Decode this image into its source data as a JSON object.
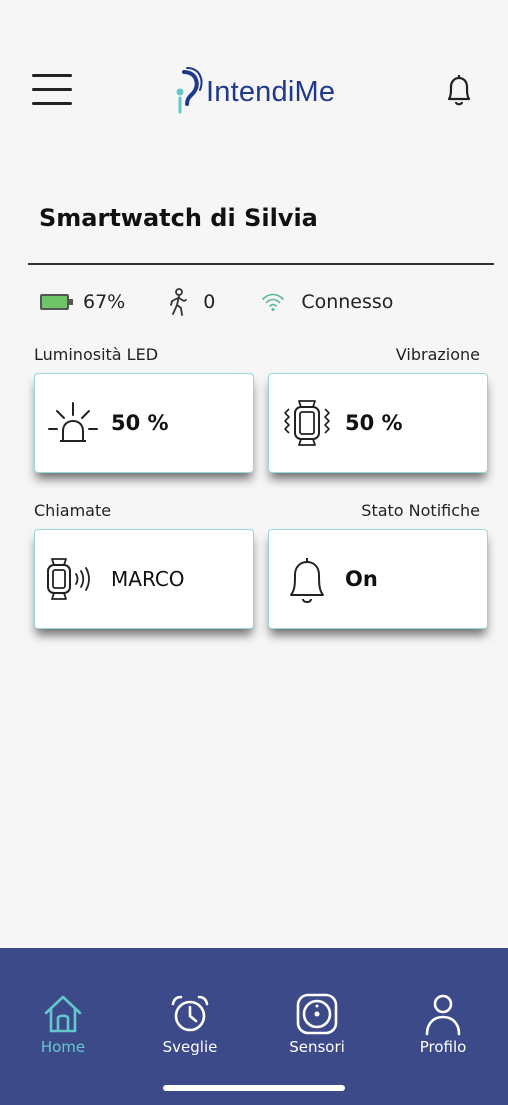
{
  "header": {
    "logo_text": "IntendiMe"
  },
  "device": {
    "title": "Smartwatch di Silvia",
    "battery": "67%",
    "steps": "0",
    "connection": "Connesso"
  },
  "sections": {
    "led_label": "Luminosità LED",
    "led_value": "50 %",
    "vibration_label": "Vibrazione",
    "vibration_value": "50 %",
    "calls_label": "Chiamate",
    "calls_value": "MARCO",
    "notifications_label": "Stato Notifiche",
    "notifications_value": "On"
  },
  "nav": {
    "items": [
      {
        "label": "Home",
        "icon": "home-icon",
        "active": true
      },
      {
        "label": "Sveglie",
        "icon": "alarm-clock-icon",
        "active": false
      },
      {
        "label": "Sensori",
        "icon": "sensor-icon",
        "active": false
      },
      {
        "label": "Profilo",
        "icon": "user-icon",
        "active": false
      }
    ]
  },
  "colors": {
    "accent": "#64c7cc",
    "nav_bg": "#3d4a8a",
    "brand": "#1f3a8a",
    "battery": "#6fc46a"
  }
}
